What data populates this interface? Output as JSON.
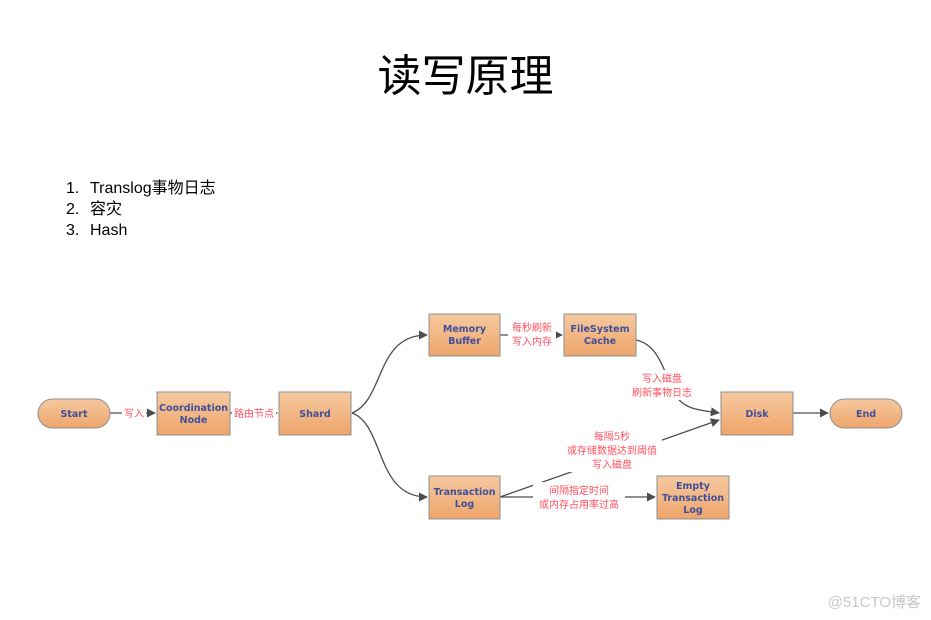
{
  "title": "读写原理",
  "list_items": [
    {
      "num": "1.",
      "text": "Translog事物日志"
    },
    {
      "num": "2.",
      "text": "容灾"
    },
    {
      "num": "3.",
      "text": "Hash"
    }
  ],
  "colors": {
    "node_fill_top": "#f6c9a0",
    "node_fill_bottom": "#eea56b",
    "node_stroke": "#8f8f8f",
    "node_text": "#3f4f9a",
    "edge_label": "#ff4f5f",
    "edge": "#4d4d4d"
  },
  "nodes": {
    "start": [
      "Start"
    ],
    "coord": [
      "Coordination",
      "Node"
    ],
    "shard": [
      "Shard"
    ],
    "membuf": [
      "Memory",
      "Buffer"
    ],
    "fscache": [
      "FileSystem",
      "Cache"
    ],
    "disk": [
      "Disk"
    ],
    "end": [
      "End"
    ],
    "translog": [
      "Transaction",
      "Log"
    ],
    "emptylog": [
      "Empty",
      "Transaction",
      "Log"
    ]
  },
  "edge_labels": {
    "start_coord": [
      "写入"
    ],
    "coord_shard": [
      "路由节点"
    ],
    "membuf_fscache": [
      "每秒刷新",
      "写入内存"
    ],
    "fscache_disk": [
      "写入磁盘",
      "刷新事物日志"
    ],
    "translog_disk": [
      "每隔5秒",
      "或存储数据达到阈值",
      "写入磁盘"
    ],
    "translog_emptylog": [
      "间隔指定时间",
      "或内存占用率过高"
    ]
  },
  "watermark": "@51CTO博客"
}
